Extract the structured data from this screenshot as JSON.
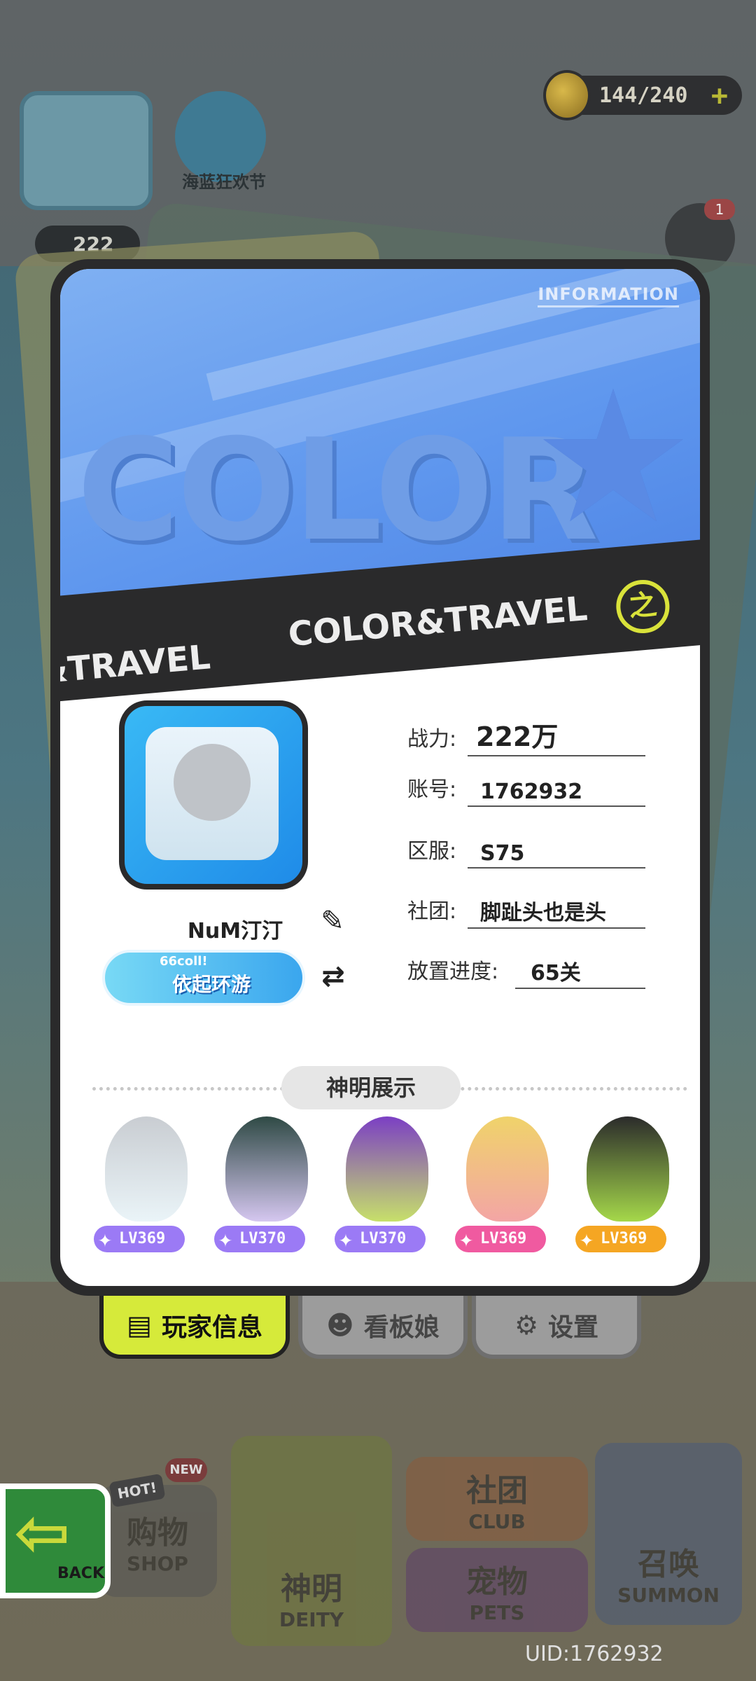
{
  "top_bar": {
    "stamina": "144/240",
    "stamina_plus": "+",
    "event_label": "海蓝狂欢节",
    "power_chip": "222",
    "mail_badge_count": "1"
  },
  "card": {
    "info_tag": "INFORMATION",
    "banner_word": "COLOR",
    "stripe_left": "&TRAVEL",
    "stripe_right": "COLOR&TRAVEL",
    "stripe_logo": "之"
  },
  "profile": {
    "nickname": "NuM汀汀",
    "title_badge_small": "66coll!",
    "title_badge_main": "依起环游",
    "stats": {
      "power_label": "战力:",
      "power_value": "222万",
      "account_label": "账号:",
      "account_value": "1762932",
      "server_label": "区服:",
      "server_value": "S75",
      "club_label": "社团:",
      "club_value": "脚趾头也是头",
      "progress_label": "放置进度:",
      "progress_value": "65关"
    }
  },
  "deity_showcase": {
    "title": "神明展示",
    "deities": [
      {
        "level": "LV369",
        "color": "#9b7af5"
      },
      {
        "level": "LV370",
        "color": "#9b7af5"
      },
      {
        "level": "LV370",
        "color": "#9b7af5"
      },
      {
        "level": "LV369",
        "color": "#f05aa0"
      },
      {
        "level": "LV369",
        "color": "#f5a623"
      }
    ]
  },
  "tabs": [
    {
      "label": "玩家信息",
      "icon": "info-card-icon",
      "active": true
    },
    {
      "label": "看板娘",
      "icon": "person-icon",
      "active": false
    },
    {
      "label": "设置",
      "icon": "gear-icon",
      "active": false
    }
  ],
  "bottom_nav": {
    "back": "BACK",
    "hot": "HOT!",
    "new": "NEW",
    "shop_cn": "购物",
    "shop_en": "SHOP",
    "deity_cn": "神明",
    "deity_en": "DEITY",
    "club_cn": "社团",
    "club_en": "CLUB",
    "pets_cn": "宠物",
    "pets_en": "PETS",
    "summon_cn": "召唤",
    "summon_en": "SUMMON"
  },
  "uid": "UID:1762932",
  "colors": {
    "accent_tab": "#d6ea3a",
    "banner_blue": "#5f97ee",
    "card_frame": "#2a2a2b"
  }
}
